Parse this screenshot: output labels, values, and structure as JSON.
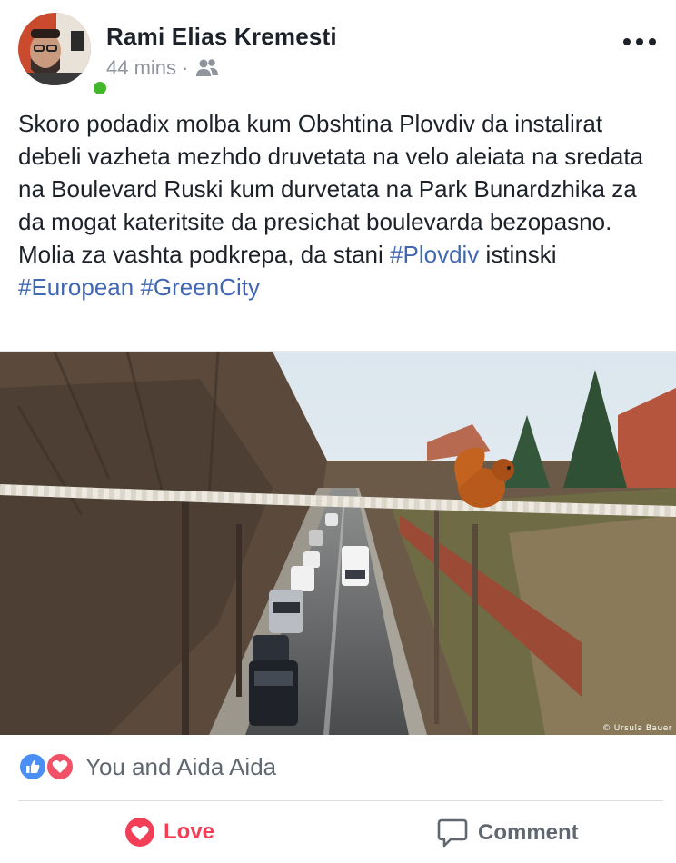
{
  "post": {
    "author": "Rami Elias Kremesti",
    "time": "44 mins",
    "separator": "·",
    "audience_icon": "friends-icon",
    "more_icon": "more-options-icon",
    "text_segments": [
      "Skoro podadix molba kum Obshtina Plovdiv da instalirat debeli vazheta mezhdo druvetata na velo aleiata na sredata na Boulevard Ruski kum durvetata na Park Bunardzhika za da mogat kateritsite da presichat boulevarda bezopasno. Molia za vashta podkrepa, da stani ",
      " istinski ",
      " "
    ],
    "hashtags": [
      "#Plovdiv",
      "#European",
      "#GreenCity"
    ],
    "photo": {
      "credit": "© Ursula Bauer"
    }
  },
  "reactions": {
    "icons": [
      "like-icon",
      "love-icon"
    ],
    "text": "You and Aida Aida"
  },
  "actions": {
    "love_label": "Love",
    "comment_label": "Comment"
  },
  "colors": {
    "hashtag": "#4267b2",
    "love": "#f33e58",
    "like": "#4b8ef5",
    "online": "#42b72a"
  }
}
